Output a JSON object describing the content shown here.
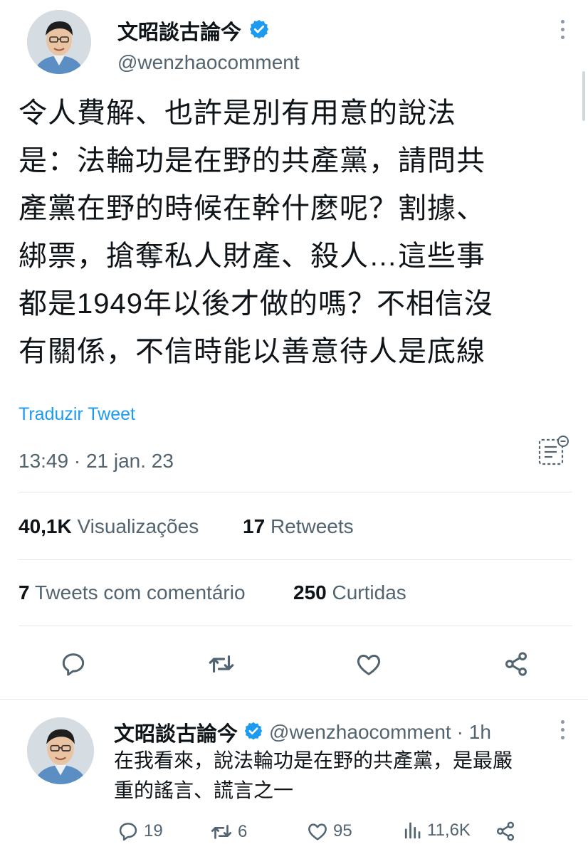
{
  "tweet": {
    "author_name": "文昭談古論今",
    "author_handle": "@wenzhaocomment",
    "text_lines": [
      "令人費解、也許是別有用意的說法",
      "是：法輪功是在野的共產黨，請問共",
      "產黨在野的時候在幹什麼呢？割據、",
      "綁票，搶奪私人財產、殺人…這些事",
      "都是1949年以後才做的嗎？不相信沒",
      "有關係，不信時能以善意待人是底線"
    ],
    "translate_label": "Traduzir Tweet",
    "timestamp": "13:49 · 21 jan. 23",
    "views_count": "40,1K",
    "views_label": "Visualizações",
    "retweets_count": "17",
    "retweets_label": "Retweets",
    "quotes_count": "7",
    "quotes_label": "Tweets com comentário",
    "likes_count": "250",
    "likes_label": "Curtidas"
  },
  "reply": {
    "author_name": "文昭談古論今",
    "author_handle": "@wenzhaocomment",
    "time": "· 1h",
    "text_lines": [
      "在我看來，說法輪功是在野的共產黨，是最嚴",
      "重的謠言、謊言之一"
    ],
    "reply_count": "19",
    "retweet_count": "6",
    "like_count": "95",
    "views_count": "11,6K"
  },
  "icons": {
    "verified": "verified-badge-icon",
    "more": "more-vertical-icon",
    "notes": "notes-icon",
    "reply": "reply-icon",
    "retweet": "retweet-icon",
    "like": "like-icon",
    "share": "share-icon",
    "views": "views-icon"
  },
  "colors": {
    "accent": "#1d9bf0",
    "text": "#0f1419",
    "muted": "#536471",
    "divider": "#e4e8eb"
  }
}
